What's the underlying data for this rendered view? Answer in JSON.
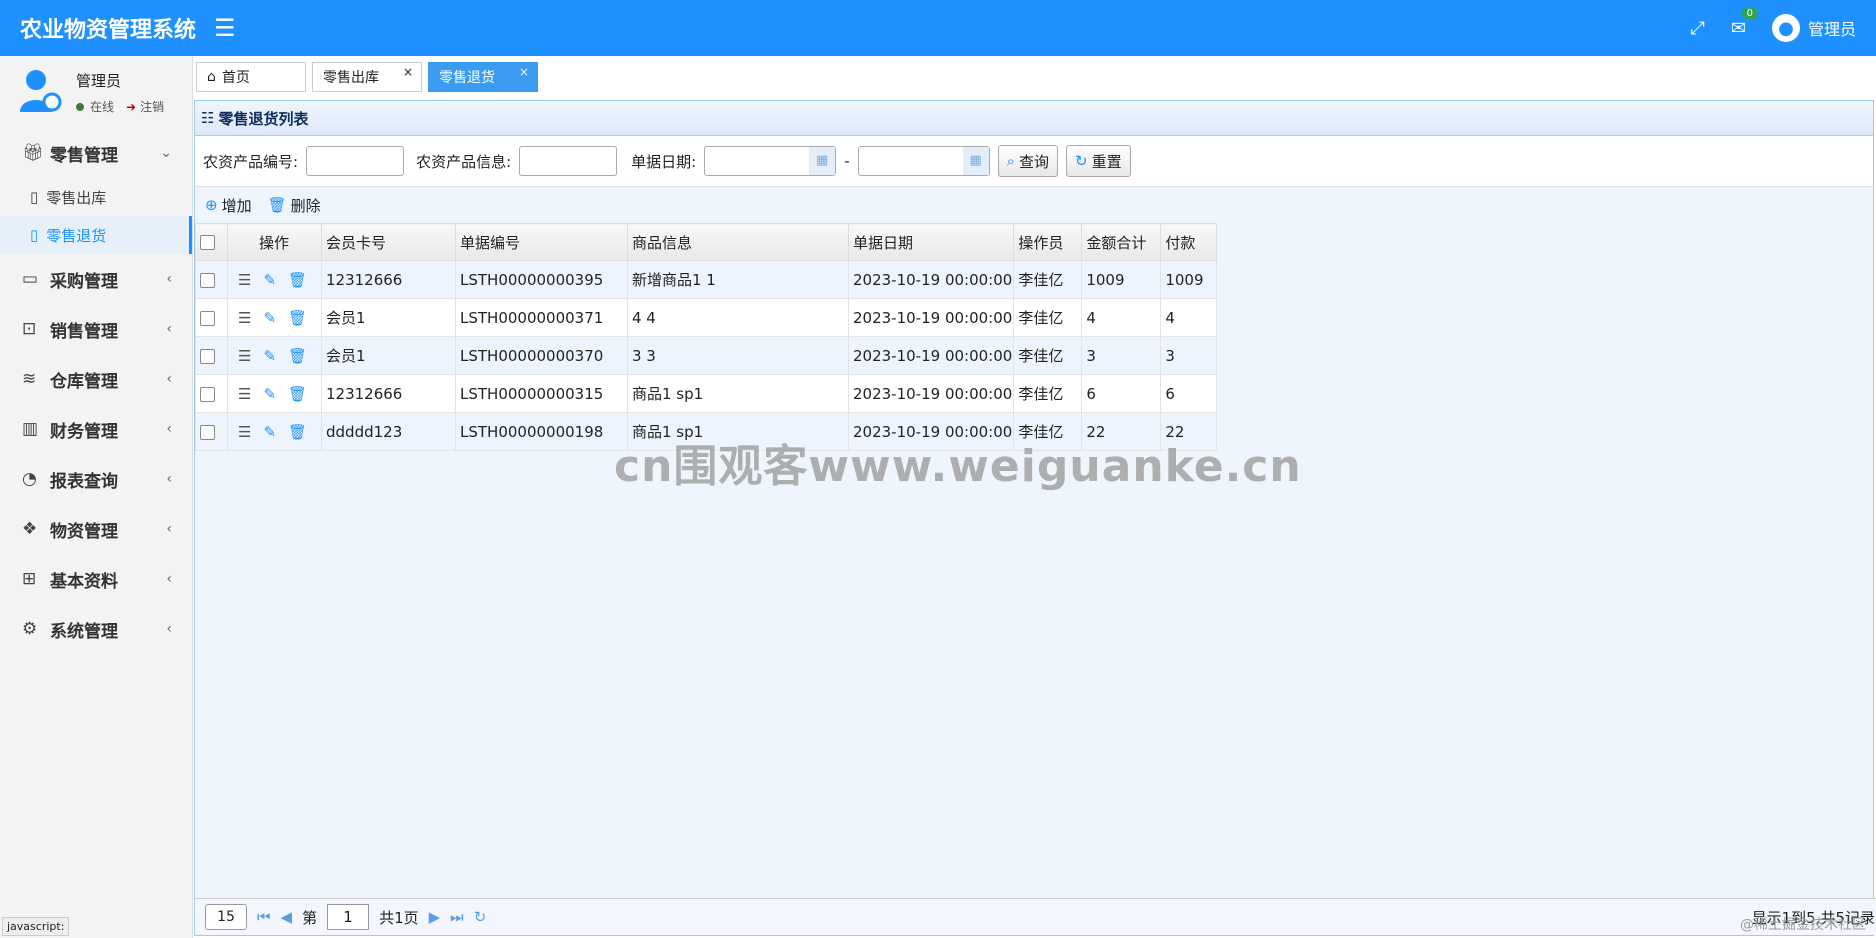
{
  "app": {
    "title": "农业物资管理系统",
    "user": "管理员",
    "mail_count": "0"
  },
  "sidebar": {
    "user_name": "管理员",
    "status": "在线",
    "logout": "注销",
    "groups": [
      {
        "label": "零售管理",
        "icon": "gift-icon"
      },
      {
        "label": "采购管理",
        "icon": "monitor-icon"
      },
      {
        "label": "销售管理",
        "icon": "briefcase-icon"
      },
      {
        "label": "仓库管理",
        "icon": "layers-icon"
      },
      {
        "label": "财务管理",
        "icon": "book-icon"
      },
      {
        "label": "报表查询",
        "icon": "pie-icon"
      },
      {
        "label": "物资管理",
        "icon": "boxes-icon"
      },
      {
        "label": "基本资料",
        "icon": "grid-icon"
      },
      {
        "label": "系统管理",
        "icon": "gear-icon"
      }
    ],
    "sub_items": [
      {
        "label": "零售出库"
      },
      {
        "label": "零售退货"
      }
    ]
  },
  "tabs": [
    {
      "label": "首页"
    },
    {
      "label": "零售出库"
    },
    {
      "label": "零售退货"
    }
  ],
  "panel": {
    "title": "零售退货列表"
  },
  "search": {
    "code_label": "农资产品编号:",
    "info_label": "农资产品信息:",
    "date_label": "单据日期:",
    "query": "查询",
    "reset": "重置"
  },
  "toolbar": {
    "add": "增加",
    "delete": "删除"
  },
  "table": {
    "headers": [
      "操作",
      "会员卡号",
      "单据编号",
      "商品信息",
      "单据日期",
      "操作员",
      "金额合计",
      "付款"
    ],
    "rows": [
      [
        "12312666",
        "LSTH00000000395",
        "新增商品1 1",
        "2023-10-19 00:00:00",
        "李佳亿",
        "1009",
        "1009"
      ],
      [
        "会员1",
        "LSTH00000000371",
        "4 4",
        "2023-10-19 00:00:00",
        "李佳亿",
        "4",
        "4"
      ],
      [
        "会员1",
        "LSTH00000000370",
        "3 3",
        "2023-10-19 00:00:00",
        "李佳亿",
        "3",
        "3"
      ],
      [
        "12312666",
        "LSTH00000000315",
        "商品1 sp1",
        "2023-10-19 00:00:00",
        "李佳亿",
        "6",
        "6"
      ],
      [
        "ddddd123",
        "LSTH00000000198",
        "商品1 sp1",
        "2023-10-19 00:00:00",
        "李佳亿",
        "22",
        "22"
      ]
    ]
  },
  "pager": {
    "page_size": "15",
    "page_prefix": "第",
    "page": "1",
    "page_suffix": "共1页",
    "info": "显示1到5,共5记录"
  },
  "status_bar": "javascript:",
  "watermark": "cn围观客www.weiguanke.cn",
  "corner_mark": "@稀土掘金技术社区"
}
